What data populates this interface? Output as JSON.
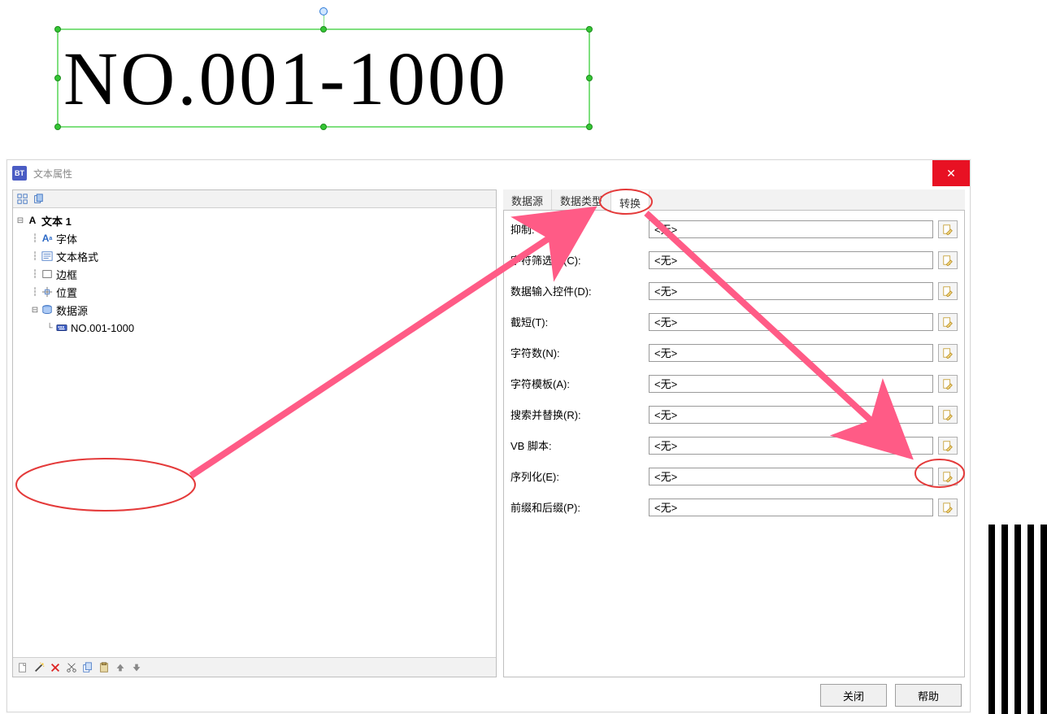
{
  "canvas": {
    "text": "NO.001-1000"
  },
  "dialog": {
    "title": "文本属性",
    "close_symbol": "✕",
    "footer": {
      "close": "关闭",
      "help": "帮助"
    }
  },
  "tree": {
    "root": "文本 1",
    "nodes": {
      "font": "字体",
      "textformat": "文本格式",
      "border": "边框",
      "position": "位置",
      "datasource": "数据源",
      "ds_child": "NO.001-1000"
    },
    "expander_collapse": "⊟",
    "expander_leaf": ""
  },
  "tabs": {
    "0": "数据源",
    "1": "数据类型",
    "2": "转换"
  },
  "form": {
    "rows": [
      {
        "label": "抑制:",
        "value": "<无>"
      },
      {
        "label": "字符筛选器(C):",
        "value": "<无>"
      },
      {
        "label": "数据输入控件(D):",
        "value": "<无>"
      },
      {
        "label": "截短(T):",
        "value": "<无>"
      },
      {
        "label": "字符数(N):",
        "value": "<无>"
      },
      {
        "label": "字符模板(A):",
        "value": "<无>"
      },
      {
        "label": "搜索并替换(R):",
        "value": "<无>"
      },
      {
        "label": "VB 脚本:",
        "value": "<无>"
      },
      {
        "label": "序列化(E):",
        "value": "<无>"
      },
      {
        "label": "前缀和后缀(P):",
        "value": "<无>"
      }
    ]
  }
}
